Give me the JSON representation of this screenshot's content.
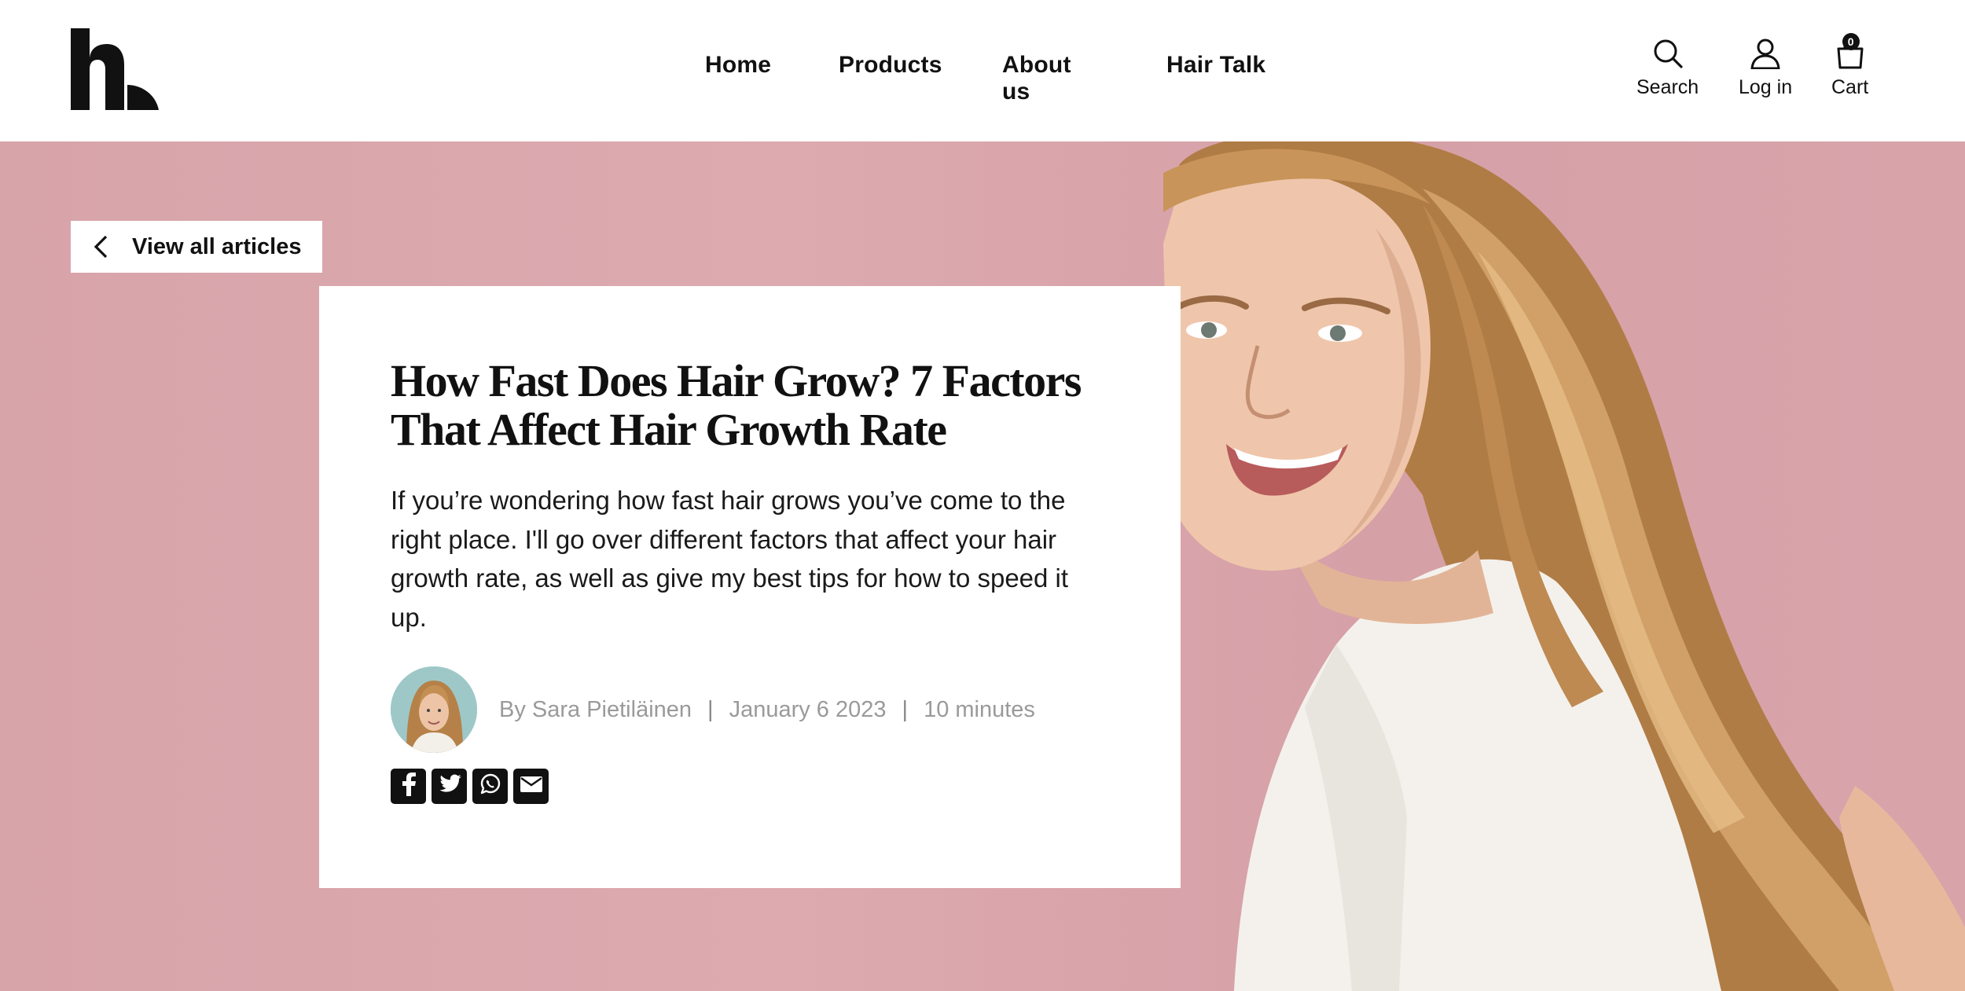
{
  "header": {
    "nav": {
      "home": "Home",
      "products": "Products",
      "about": "About us",
      "hair_talk": "Hair Talk"
    },
    "utilities": {
      "search": "Search",
      "login": "Log in",
      "cart": "Cart",
      "cart_count": "0"
    }
  },
  "hero": {
    "back_button": "View all articles",
    "article": {
      "title": "How Fast Does Hair Grow? 7 Factors That Affect Hair Growth Rate",
      "intro": "If you’re wondering how fast hair grows you’ve come to the right place. I'll go over different factors that affect your hair growth rate, as well as give my best tips for how to speed it up.",
      "author": "By Sara Pietiläinen",
      "date": "January 6 2023",
      "read_time": "10 minutes",
      "separator": "|"
    },
    "share": [
      "facebook-icon",
      "twitter-icon",
      "whatsapp-icon",
      "email-icon"
    ]
  },
  "colors": {
    "hero_background": "#d8a6ab",
    "text": "#111111",
    "meta_text": "#9a9a9a"
  }
}
